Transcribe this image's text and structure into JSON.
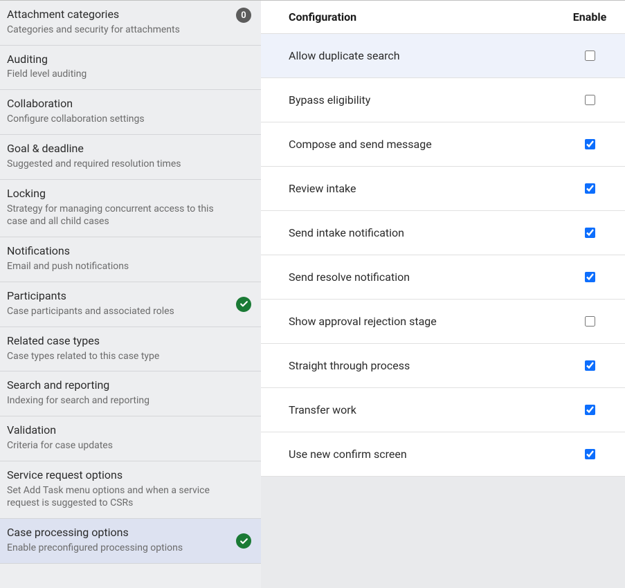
{
  "sidebar": {
    "items": [
      {
        "title": "Attachment categories",
        "desc": "Categories and security for attachments",
        "badge": "0"
      },
      {
        "title": "Auditing",
        "desc": "Field level auditing"
      },
      {
        "title": "Collaboration",
        "desc": "Configure collaboration settings"
      },
      {
        "title": "Goal & deadline",
        "desc": "Suggested and required resolution times"
      },
      {
        "title": "Locking",
        "desc": "Strategy for managing concurrent access to this case and all child cases"
      },
      {
        "title": "Notifications",
        "desc": "Email and push notifications"
      },
      {
        "title": "Participants",
        "desc": "Case participants and associated roles",
        "check": true
      },
      {
        "title": "Related case types",
        "desc": "Case types related to this case type"
      },
      {
        "title": "Search and reporting",
        "desc": "Indexing for search and reporting"
      },
      {
        "title": "Validation",
        "desc": "Criteria for case updates"
      },
      {
        "title": "Service request options",
        "desc": "Set Add Task menu options and when a service request is suggested to CSRs"
      },
      {
        "title": "Case processing options",
        "desc": "Enable preconfigured processing options",
        "check": true,
        "selected": true
      }
    ]
  },
  "config": {
    "header": {
      "title": "Configuration",
      "enable": "Enable"
    },
    "rows": [
      {
        "label": "Allow duplicate search",
        "enabled": false,
        "highlighted": true
      },
      {
        "label": "Bypass eligibility",
        "enabled": false
      },
      {
        "label": "Compose and send message",
        "enabled": true
      },
      {
        "label": "Review intake",
        "enabled": true
      },
      {
        "label": "Send intake notification",
        "enabled": true
      },
      {
        "label": "Send resolve notification",
        "enabled": true
      },
      {
        "label": "Show approval rejection stage",
        "enabled": false
      },
      {
        "label": "Straight through process",
        "enabled": true
      },
      {
        "label": "Transfer work",
        "enabled": true
      },
      {
        "label": "Use new confirm screen",
        "enabled": true
      }
    ]
  }
}
